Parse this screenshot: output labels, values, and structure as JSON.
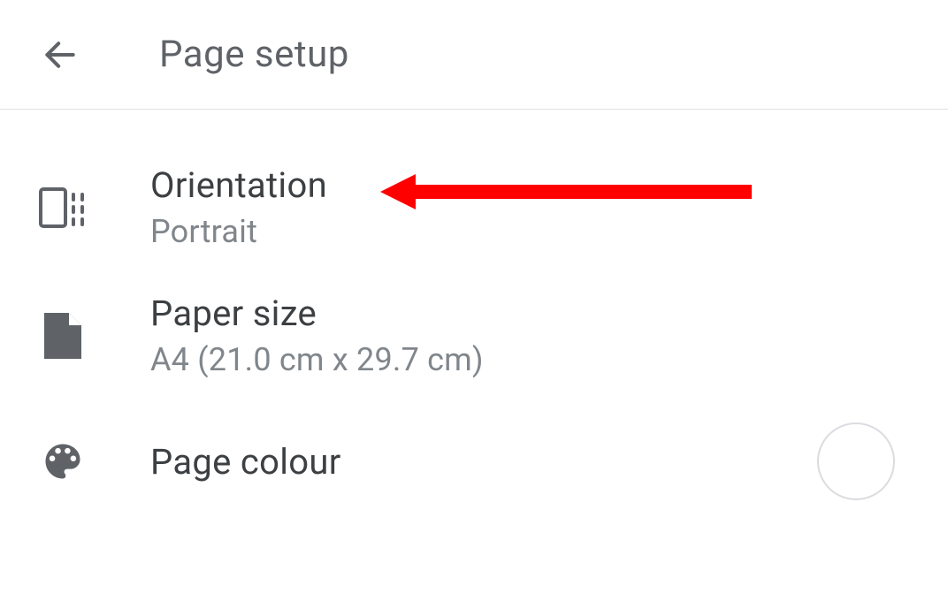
{
  "header": {
    "title": "Page setup"
  },
  "settings": {
    "orientation": {
      "label": "Orientation",
      "value": "Portrait"
    },
    "paperSize": {
      "label": "Paper size",
      "value": "A4 (21.0 cm x 29.7 cm)"
    },
    "pageColour": {
      "label": "Page colour",
      "colorHex": "#ffffff"
    }
  },
  "annotation": {
    "arrowColor": "#ff0000"
  }
}
